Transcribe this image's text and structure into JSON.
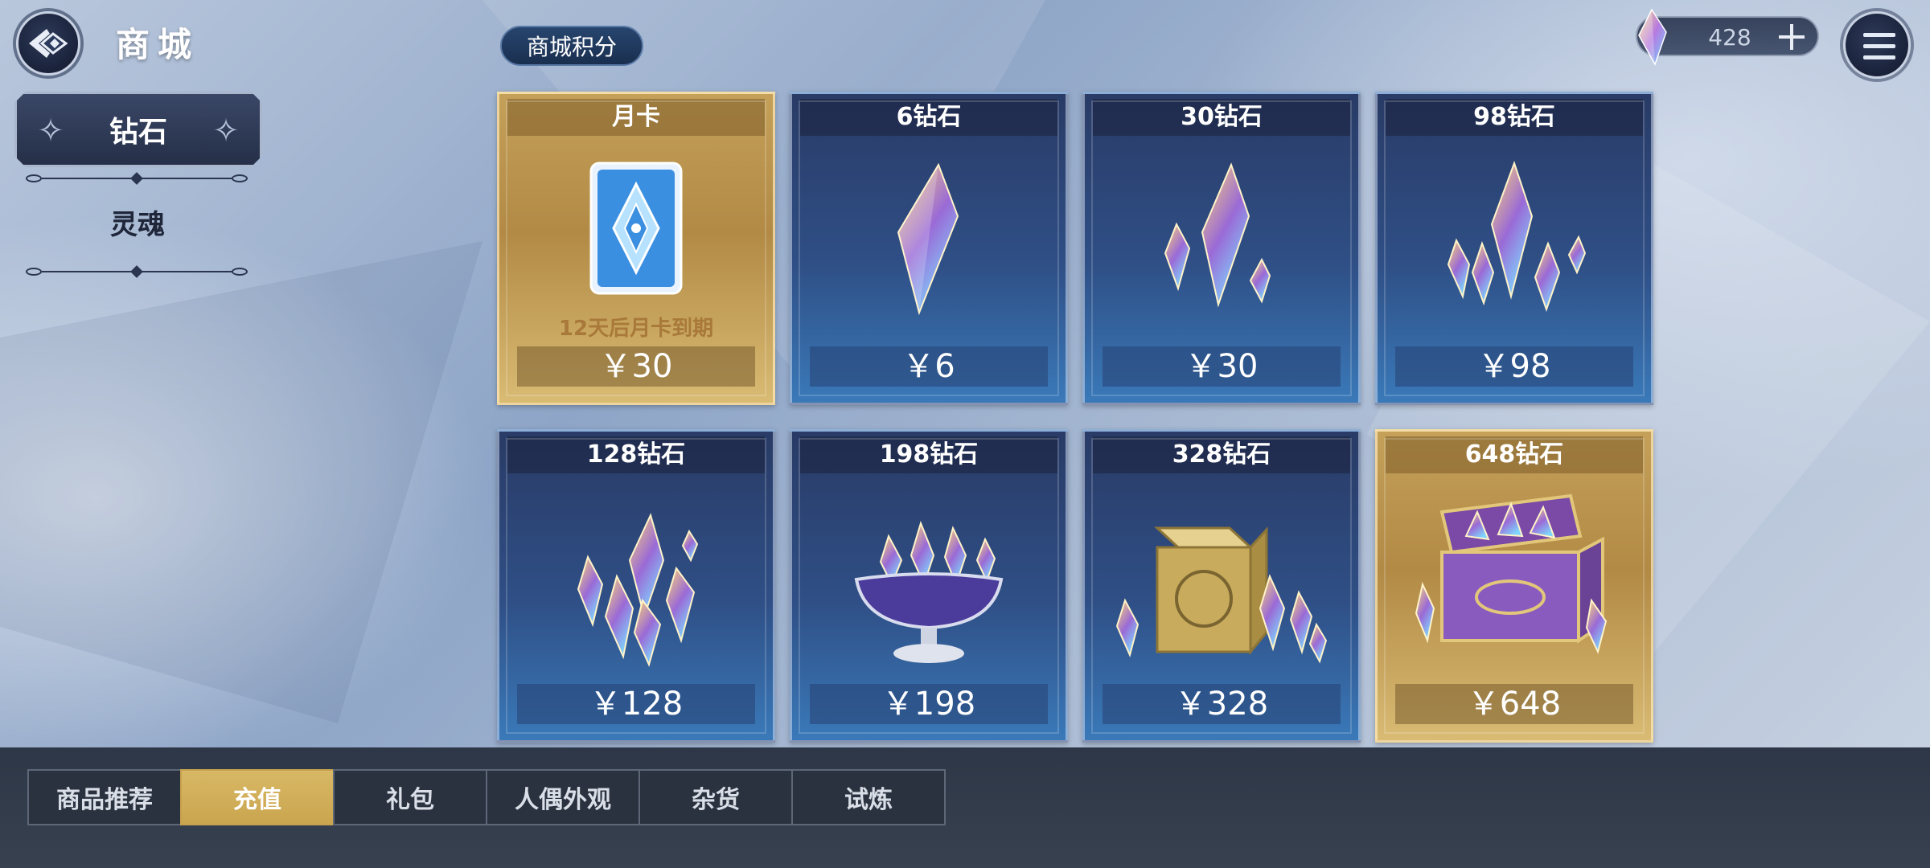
{
  "header": {
    "title": "商城",
    "back_icon": "back-arrow-icon",
    "menu_icon": "hamburger-menu-icon"
  },
  "sidebar": {
    "items": [
      {
        "label": "钻石",
        "active": true
      },
      {
        "label": "灵魂",
        "active": false
      }
    ]
  },
  "points_button": {
    "label": "商城积分"
  },
  "currency": {
    "amount": "428",
    "icon": "diamond-icon",
    "add_icon": "plus-icon"
  },
  "products": [
    {
      "title": "月卡",
      "price": "￥30",
      "note": "12天后月卡到期",
      "style": "gold",
      "art": "month-card"
    },
    {
      "title": "6钻石",
      "price": "￥6",
      "note": "",
      "style": "blue",
      "art": "gem-1"
    },
    {
      "title": "30钻石",
      "price": "￥30",
      "note": "",
      "style": "blue",
      "art": "gem-3"
    },
    {
      "title": "98钻石",
      "price": "￥98",
      "note": "",
      "style": "blue",
      "art": "gem-5"
    },
    {
      "title": "128钻石",
      "price": "￥128",
      "note": "",
      "style": "blue",
      "art": "gem-pile"
    },
    {
      "title": "198钻石",
      "price": "￥198",
      "note": "",
      "style": "blue",
      "art": "gem-bowl"
    },
    {
      "title": "328钻石",
      "price": "￥328",
      "note": "",
      "style": "blue",
      "art": "gem-box"
    },
    {
      "title": "648钻石",
      "price": "￥648",
      "note": "",
      "style": "gold",
      "art": "gem-chest"
    }
  ],
  "tabs": [
    {
      "label": "商品推荐",
      "active": false
    },
    {
      "label": "充值",
      "active": true
    },
    {
      "label": "礼包",
      "active": false
    },
    {
      "label": "人偶外观",
      "active": false
    },
    {
      "label": "杂货",
      "active": false
    },
    {
      "label": "试炼",
      "active": false
    }
  ],
  "colors": {
    "accent_gold": "#d8b865",
    "card_blue": "#2f4f86",
    "card_gold": "#c4a059",
    "expiry_text": "#a8793a"
  }
}
